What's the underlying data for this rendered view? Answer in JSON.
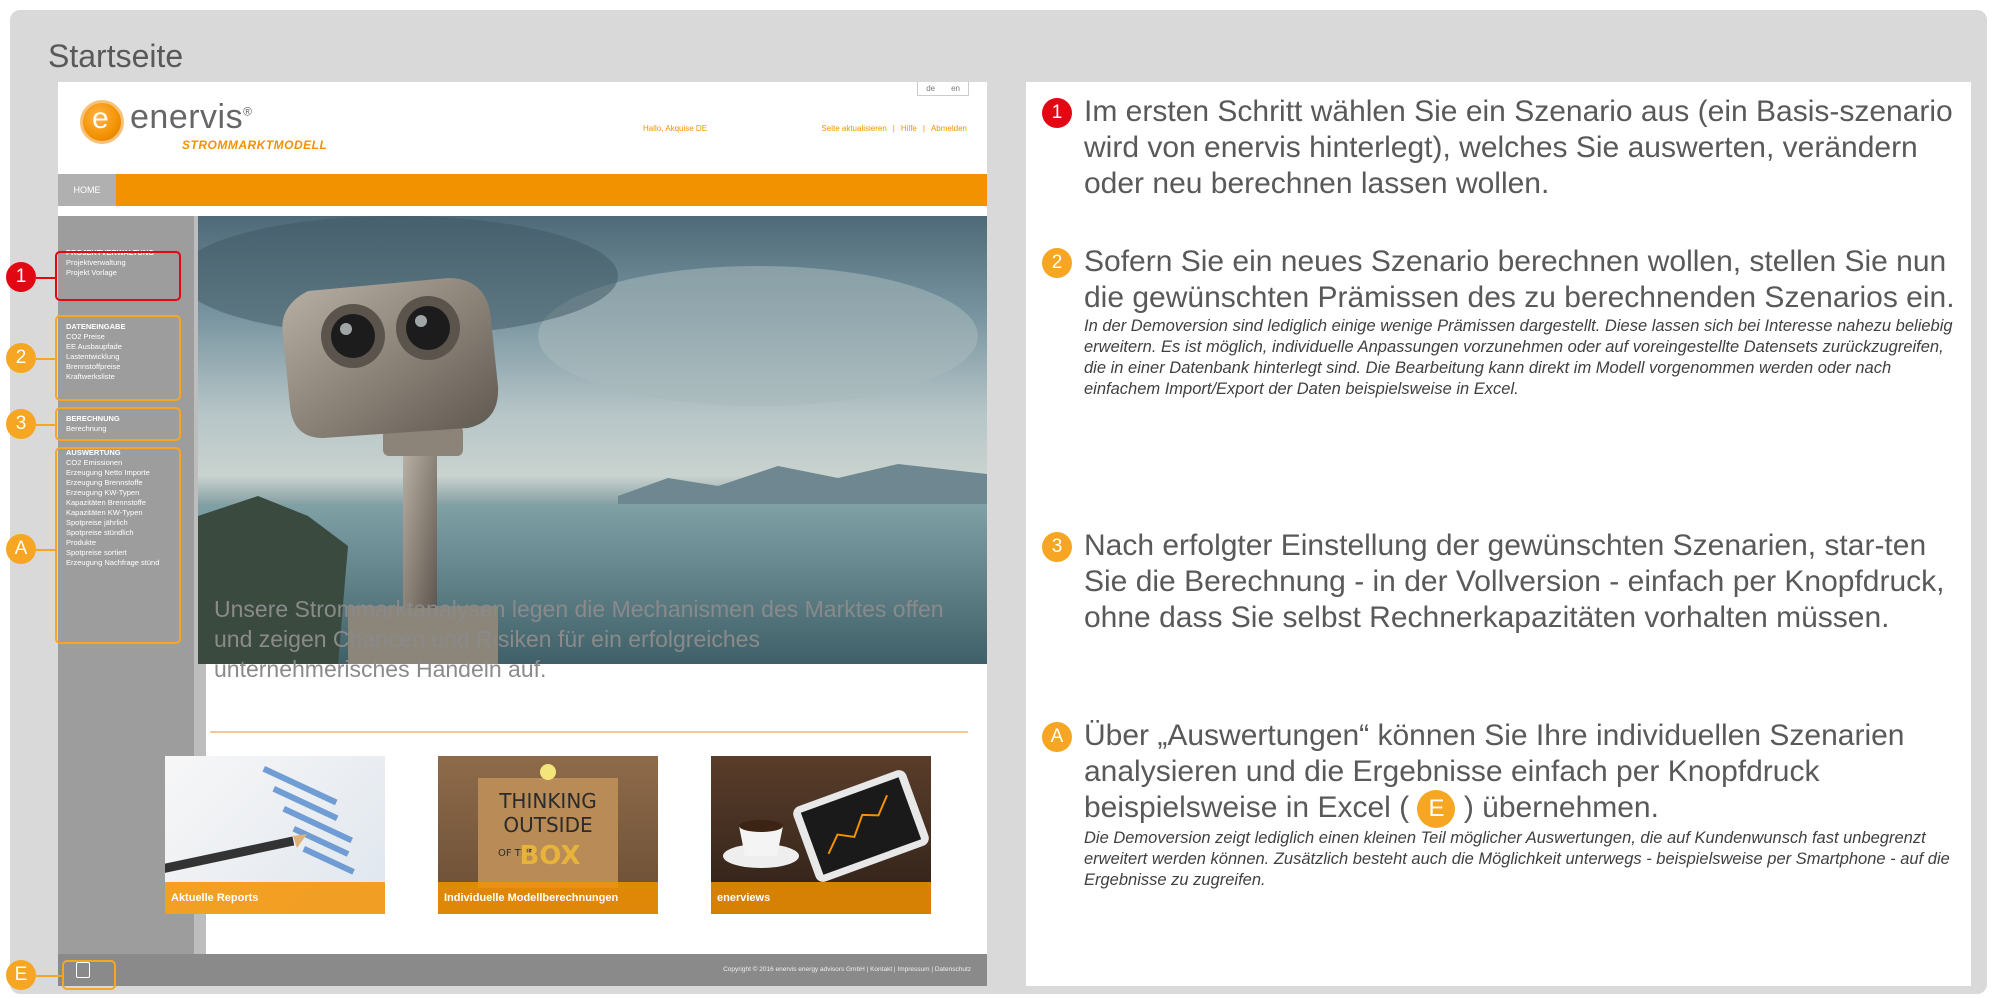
{
  "page": {
    "title": "Startseite"
  },
  "app": {
    "lang": [
      "de",
      "en"
    ],
    "logo": {
      "name": "enervis",
      "mark": "e",
      "reg": "®",
      "sub": "STROMMARKTMODELL"
    },
    "greeting": "Hallo, Akquise DE",
    "toplinks": [
      "Seite aktualisieren",
      "|",
      "Hilfe",
      "|",
      "Abmelden"
    ],
    "nav_home": "HOME",
    "sidebar": {
      "projekt": {
        "head": "PROJEKTVERWALTUNG",
        "items": [
          "Projektverwaltung",
          "Projekt Vorlage"
        ]
      },
      "daten": {
        "head": "DATENEINGABE",
        "items": [
          "CO2 Preise",
          "EE Ausbaupfade",
          "Lastentwicklung",
          "Brennstoffpreise",
          "Kraftwerksliste"
        ]
      },
      "berechnung": {
        "head": "BERECHNUNG",
        "items": [
          "Berechnung"
        ]
      },
      "auswertung": {
        "head": "AUSWERTUNG",
        "items": [
          "CO2 Emissionen",
          "Erzeugung Netto Importe",
          "Erzeugung Brennstoffe",
          "Erzeugung KW-Typen",
          "Kapazitäten Brennstoffe",
          "Kapazitäten KW-Typen",
          "Spotpreise jährlich",
          "Spotpreise stündlich",
          "Produkte",
          "Spotpreise sortiert",
          "Erzeugung Nachfrage stünd"
        ]
      }
    },
    "tagline": "Unsere Strommarktanalysen legen die Mechanismen des Marktes offen und zeigen Chancen und Risiken für ein erfolgreiches unternehmerisches Handeln auf.",
    "tiles": [
      "Aktuelle Reports",
      "Individuelle Modellberechnungen",
      "enerviews"
    ],
    "thinking": {
      "l1": "THINKING",
      "l2": "OUTSIDE",
      "l3": "BOX",
      "l4": "OF THE"
    },
    "footer": "Copyright © 2016 enervis energy advisors GmbH  |  Kontakt  |  Impressum  |  Datenschutz"
  },
  "markers": {
    "m1": "1",
    "m2": "2",
    "m3": "3",
    "mA": "A",
    "mE": "E"
  },
  "colors": {
    "orange": "#f39200",
    "marker_orange": "#f6a623",
    "marker_red": "#e30613"
  },
  "steps": {
    "s1": {
      "badge": "1",
      "text": "Im ersten Schritt wählen Sie ein Szenario aus (ein Basis-szenario wird von enervis hinterlegt), welches Sie auswerten, verändern oder neu berechnen lassen wollen."
    },
    "s2": {
      "badge": "2",
      "text": "Sofern Sie ein neues Szenario berechnen wollen, stellen Sie nun die gewünschten Prämissen des zu berechnenden Szenarios ein.",
      "note": "In der Demoversion sind lediglich einige wenige Prämissen dargestellt. Diese lassen sich bei Interesse nahezu beliebig erweitern. Es ist möglich, individuelle Anpassungen vorzunehmen oder auf voreingestellte Datensets zurückzugreifen, die in einer Datenbank hinterlegt sind. Die Bearbeitung kann direkt im Modell vorgenommen werden oder nach einfachem Import/Export der Daten beispielsweise in Excel."
    },
    "s3": {
      "badge": "3",
      "text": "Nach erfolgter Einstellung der gewünschten Szenarien, star-ten Sie die Berechnung - in der Vollversion - einfach per Knopfdruck, ohne dass Sie selbst Rechnerkapazitäten vorhalten müssen."
    },
    "sA": {
      "badge": "A",
      "text_a": "Über „Auswertungen“ können Sie Ihre individuellen Szenarien analysieren und die Ergebnisse einfach per Knopfdruck beispielsweise in Excel (",
      "inline": "E",
      "text_b": ")  übernehmen.",
      "note": "Die Demoversion zeigt lediglich einen kleinen Teil möglicher Auswertungen, die auf Kundenwunsch fast unbegrenzt erweitert werden können. Zusätzlich besteht auch die Möglichkeit unterwegs - beispielsweise per Smartphone - auf die Ergebnisse zu zugreifen."
    }
  }
}
